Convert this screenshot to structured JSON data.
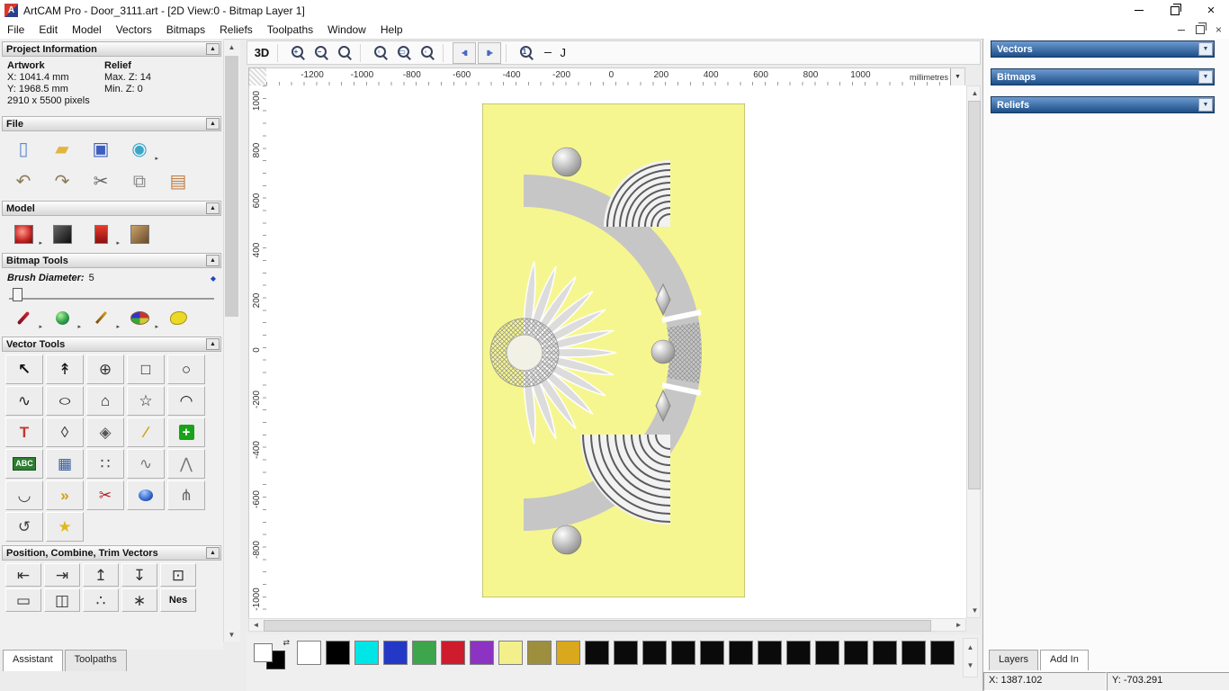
{
  "window": {
    "title": "ArtCAM Pro - Door_3111.art - [2D View:0 - Bitmap Layer 1]"
  },
  "menubar": {
    "items": [
      "File",
      "Edit",
      "Model",
      "Vectors",
      "Bitmaps",
      "Reliefs",
      "Toolpaths",
      "Window",
      "Help"
    ]
  },
  "left_panel": {
    "sections": [
      {
        "title": "Project Information"
      },
      {
        "title": "File"
      },
      {
        "title": "Model"
      },
      {
        "title": "Bitmap Tools"
      },
      {
        "title": "Vector Tools"
      },
      {
        "title": "Position, Combine, Trim Vectors"
      }
    ],
    "project_info": {
      "artwork_label": "Artwork",
      "relief_label": "Relief",
      "x": "X: 1041.4 mm",
      "y": "Y: 1968.5 mm",
      "max_z": "Max. Z: 14",
      "min_z": "Min. Z: 0",
      "pixels": "2910 x 5500 pixels"
    },
    "bitmap": {
      "brush_label": "Brush Diameter:",
      "brush_value": "5"
    },
    "file_tools_r1": [
      {
        "n": "new-model-icon",
        "g": "▯",
        "c": "#5b87cf"
      },
      {
        "n": "open-model-icon",
        "g": "▰",
        "c": "#e3b53f"
      },
      {
        "n": "save-model-icon",
        "g": "▣",
        "c": "#3d5fc0"
      },
      {
        "n": "import-export-icon",
        "g": "◉",
        "c": "#3aa7c9",
        "dd": true
      }
    ],
    "file_tools_r2": [
      {
        "n": "undo-icon",
        "g": "↶",
        "c": "#8a7a5a"
      },
      {
        "n": "redo-icon",
        "g": "↷",
        "c": "#8a7a5a"
      },
      {
        "n": "cut-icon",
        "g": "✂",
        "c": "#666666"
      },
      {
        "n": "copy-icon",
        "g": "⧉",
        "c": "#8a8a8a"
      },
      {
        "n": "paste-icon",
        "g": "▤",
        "c": "#c08048"
      }
    ],
    "model_tools": [
      {
        "n": "model-properties-icon",
        "cls": "pic pic-red",
        "dd": true
      },
      {
        "n": "greyscale-view-icon",
        "cls": "pic pic-dark"
      },
      {
        "n": "relief-clipart-icon",
        "cls": "pic pic-red2",
        "dd": true
      },
      {
        "n": "load-picture-icon",
        "cls": "pic pic-art"
      }
    ],
    "bitmap_tools": [
      {
        "n": "paint-brush-icon",
        "cls": "shape-brush",
        "dd": true
      },
      {
        "n": "colour-blend-icon",
        "cls": "shape-sphere",
        "dd": true
      },
      {
        "n": "draw-pencil-icon",
        "cls": "shape-pencil",
        "dd": true
      },
      {
        "n": "colour-palette-icon",
        "cls": "shape-palette",
        "dd": true
      },
      {
        "n": "flood-fill-icon",
        "cls": "shape-blob"
      }
    ],
    "vector_tools_r1": [
      {
        "n": "select-vectors-tool",
        "g": "↖",
        "c": "#111111",
        "cls": "boldtxt"
      },
      {
        "n": "node-editing-tool",
        "g": "↟",
        "c": "#111111"
      },
      {
        "n": "transform-vectors-tool",
        "g": "⊕",
        "c": "#333333"
      },
      {
        "n": "create-rectangle-tool",
        "g": "□",
        "c": "#222222"
      },
      {
        "n": "create-circle-tool",
        "g": "○",
        "c": "#222222"
      }
    ],
    "vector_tools_r2": [
      {
        "n": "create-polyline-tool",
        "g": "∿",
        "c": "#222222"
      },
      {
        "n": "create-ellipse-tool",
        "g": "○",
        "c": "#222222",
        "cls": "wide"
      },
      {
        "n": "create-polygon-tool",
        "g": "⌂",
        "c": "#222222"
      },
      {
        "n": "create-star-tool",
        "g": "☆",
        "c": "#222222"
      },
      {
        "n": "create-arc-tool",
        "g": "◠",
        "c": "#222222"
      }
    ],
    "vector_tools_r3": [
      {
        "n": "create-text-tool",
        "g": "T",
        "c": "#c0392b",
        "cls": "boldtxt"
      },
      {
        "n": "wrap-text-tool",
        "g": "◊",
        "c": "#333333"
      },
      {
        "n": "create-diamond-tool",
        "g": "◈",
        "c": "#555555"
      },
      {
        "n": "dimension-tool",
        "g": "∕",
        "c": "#d1a016",
        "cls": "boldtxt"
      },
      {
        "n": "block-copy-tool",
        "g": "+",
        "cls": "green-plus"
      }
    ],
    "vector_tools_r4": [
      {
        "n": "convert-text-tool",
        "g": "ABC",
        "cls": "abc"
      },
      {
        "n": "vector-grid-tool",
        "g": "▦",
        "c": "#335a9a"
      },
      {
        "n": "scatter-points-tool",
        "g": "∷",
        "c": "#444444"
      },
      {
        "n": "fit-curve-tool",
        "g": "∿",
        "c": "#777777"
      },
      {
        "n": "fit-polyline-tool",
        "g": "⋀",
        "c": "#777777"
      }
    ],
    "vector_tools_r5": [
      {
        "n": "fillet-tool",
        "g": "◡",
        "c": "#444444"
      },
      {
        "n": "join-vectors-tool",
        "g": "»",
        "c": "#d1a016",
        "cls": "boldtxt"
      },
      {
        "n": "trim-vectors-tool",
        "g": "✂",
        "c": "#b02020"
      },
      {
        "n": "interactive-distortion-tool",
        "cls": "shape-lathe"
      },
      {
        "n": "spline-tool",
        "g": "⋔",
        "c": "#666666"
      }
    ],
    "vector_tools_r6": [
      {
        "n": "mirror-vectors-tool",
        "g": "↺",
        "c": "#444444"
      },
      {
        "n": "star-wizard-tool",
        "g": "★",
        "c": "#e2b818"
      }
    ],
    "position_tools_r1": [
      {
        "n": "align-left-icon",
        "g": "⇤",
        "c": "#333333"
      },
      {
        "n": "align-right-icon",
        "g": "⇥",
        "c": "#333333"
      },
      {
        "n": "align-top-icon",
        "g": "↥",
        "c": "#333333"
      },
      {
        "n": "align-bottom-icon",
        "g": "↧",
        "c": "#333333"
      },
      {
        "n": "center-in-page-icon",
        "g": "⊡",
        "c": "#333333"
      }
    ],
    "position_tools_r2": [
      {
        "n": "align-horizontal-icon",
        "g": "▭",
        "c": "#333333"
      },
      {
        "n": "align-vertical-icon",
        "g": "◫",
        "c": "#333333"
      },
      {
        "n": "paste-along-curve-icon",
        "g": "∴",
        "c": "#333333"
      },
      {
        "n": "block-replicate-icon",
        "g": "∗",
        "c": "#333333"
      },
      {
        "n": "nest-vectors-icon",
        "g": "Nes",
        "cls": "nes"
      }
    ],
    "tabs": [
      {
        "label": "Assistant",
        "active": true
      },
      {
        "label": "Toolpaths",
        "active": false
      }
    ]
  },
  "canvas": {
    "toolbar_buttons": [
      {
        "n": "view-3d-button",
        "label": "3D"
      },
      {
        "n": "separator",
        "cls": "sep"
      },
      {
        "n": "zoom-in-button",
        "mag": "+"
      },
      {
        "n": "zoom-out-button",
        "mag": "−"
      },
      {
        "n": "zoom-previous-button",
        "mag": " "
      },
      {
        "n": "separator",
        "cls": "sep"
      },
      {
        "n": "zoom-box-button",
        "mag": "▫"
      },
      {
        "n": "zoom-drawing-button",
        "mag": "▭"
      },
      {
        "n": "zoom-objects-button",
        "mag": "◦"
      },
      {
        "n": "separator",
        "cls": "sep"
      },
      {
        "n": "previous-bitmap-layer-button",
        "g": "◂▮",
        "c": "#4668c8",
        "cls": "boxed"
      },
      {
        "n": "next-bitmap-layer-button",
        "g": "▮▸",
        "c": "#4668c8",
        "cls": "boxed"
      },
      {
        "n": "separator",
        "cls": "sep"
      },
      {
        "n": "zoom-scale-button",
        "mag": "1"
      },
      {
        "n": "line-style-preview",
        "cls": "line-widget",
        "g": "J"
      }
    ],
    "ruler": {
      "h_labels": [
        "-1200",
        "-1000",
        "-800",
        "-600",
        "-400",
        "-200",
        "0",
        "200",
        "400",
        "600",
        "800",
        "1000"
      ],
      "v_labels": [
        "1000",
        "800",
        "600",
        "400",
        "200",
        "0",
        "-200",
        "-400",
        "-600",
        "-800",
        "-1000"
      ],
      "units": "millimetres"
    }
  },
  "right_panel": {
    "panels": [
      {
        "title": "Vectors"
      },
      {
        "title": "Bitmaps"
      },
      {
        "title": "Reliefs"
      }
    ],
    "tabs": [
      {
        "label": "Layers",
        "active": false
      },
      {
        "label": "Add In",
        "active": true
      }
    ]
  },
  "status": {
    "x": "X: 1387.102",
    "y": "Y: -703.291"
  },
  "palette": {
    "colors": [
      {
        "name": "white",
        "hex": "#ffffff"
      },
      {
        "name": "black",
        "hex": "#000000"
      },
      {
        "name": "cyan",
        "hex": "#00e5e5"
      },
      {
        "name": "blue",
        "hex": "#2438c8"
      },
      {
        "name": "green",
        "hex": "#3da54b"
      },
      {
        "name": "red",
        "hex": "#cf1b2e"
      },
      {
        "name": "purple",
        "hex": "#8c33c4"
      },
      {
        "name": "pale-yellow",
        "hex": "#f3f08c"
      },
      {
        "name": "olive",
        "hex": "#9d8f3d"
      },
      {
        "name": "gold",
        "hex": "#d9a81c"
      },
      {
        "name": "black-2",
        "hex": "#0a0a0a"
      },
      {
        "name": "black-3",
        "hex": "#0a0a0a"
      },
      {
        "name": "black-4",
        "hex": "#0a0a0a"
      },
      {
        "name": "black-5",
        "hex": "#0a0a0a"
      },
      {
        "name": "black-6",
        "hex": "#0a0a0a"
      },
      {
        "name": "black-7",
        "hex": "#0a0a0a"
      },
      {
        "name": "black-8",
        "hex": "#0a0a0a"
      },
      {
        "name": "black-9",
        "hex": "#0a0a0a"
      },
      {
        "name": "black-10",
        "hex": "#0a0a0a"
      },
      {
        "name": "black-11",
        "hex": "#0a0a0a"
      },
      {
        "name": "black-12",
        "hex": "#0a0a0a"
      },
      {
        "name": "black-13",
        "hex": "#0a0a0a"
      },
      {
        "name": "black-14",
        "hex": "#0a0a0a"
      }
    ]
  }
}
